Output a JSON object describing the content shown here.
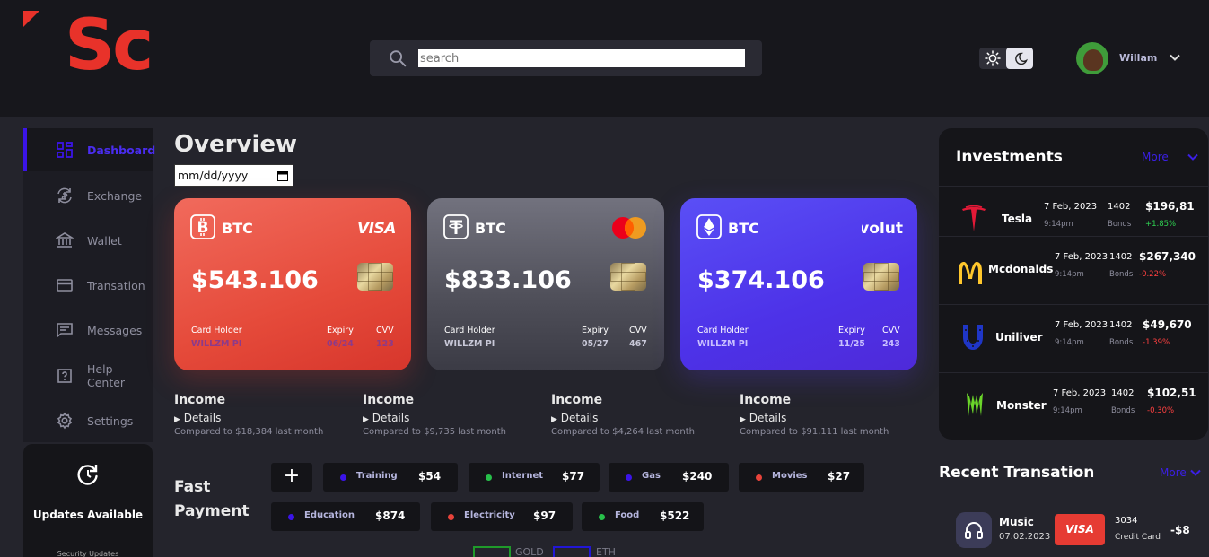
{
  "header": {
    "logo_text": "Sc",
    "search_placeholder": "search",
    "user_name": "Willam"
  },
  "sidebar": {
    "items": [
      {
        "label": "Dashboard",
        "icon": "dashboard-icon",
        "active": true
      },
      {
        "label": "Exchange",
        "icon": "exchange-icon"
      },
      {
        "label": "Wallet",
        "icon": "bank-icon"
      },
      {
        "label": "Transation",
        "icon": "card-icon"
      },
      {
        "label": "Messages",
        "icon": "message-icon"
      },
      {
        "label": "Help Center",
        "icon": "help-icon"
      },
      {
        "label": "Settings",
        "icon": "gear-icon"
      }
    ],
    "updates": {
      "title": "Updates Available",
      "subtitle": "Security Updates"
    }
  },
  "overview": {
    "title": "Overview",
    "date_value": "mm/dd/yyyy"
  },
  "cards": [
    {
      "coin": "BTC",
      "brand": "VISA",
      "amount": "$543.106",
      "holder_label": "Card Holder",
      "holder": "WILLZM PI",
      "expiry_label": "Expiry",
      "expiry": "06/24",
      "cvv_label": "CVV",
      "cvv": "123"
    },
    {
      "coin": "BTC",
      "brand": "mastercard",
      "amount": "$833.106",
      "holder_label": "Card Holder",
      "holder": "WILLZM PI",
      "expiry_label": "Expiry",
      "expiry": "05/27",
      "cvv_label": "CVV",
      "cvv": "467"
    },
    {
      "coin": "BTC",
      "brand": "Revolut",
      "amount": "$374.106",
      "holder_label": "Card Holder",
      "holder": "WILLZM PI",
      "expiry_label": "Expiry",
      "expiry": "11/25",
      "cvv_label": "CVV",
      "cvv": "243"
    }
  ],
  "income": [
    {
      "title": "Income",
      "details": "Details",
      "compare": "Compared to $18,384 last month"
    },
    {
      "title": "Income",
      "details": "Details",
      "compare": "Compared to $9,735 last month"
    },
    {
      "title": "Income",
      "details": "Details",
      "compare": "Compared to $4,264 last month"
    },
    {
      "title": "Income",
      "details": "Details",
      "compare": "Compared to $91,111 last month"
    }
  ],
  "fast_payment": {
    "title_line1": "Fast",
    "title_line2": "Payment",
    "add_label": "+",
    "items": [
      {
        "name": "Training",
        "amount": "$54",
        "color": "#3b14e8"
      },
      {
        "name": "Internet",
        "amount": "$77",
        "color": "#27c04a"
      },
      {
        "name": "Gas",
        "amount": "$240",
        "color": "#3b14e8"
      },
      {
        "name": "Movies",
        "amount": "$27",
        "color": "#e8433a"
      },
      {
        "name": "Education",
        "amount": "$874",
        "color": "#3b14e8"
      },
      {
        "name": "Electricity",
        "amount": "$97",
        "color": "#e8433a"
      },
      {
        "name": "Food",
        "amount": "$522",
        "color": "#27c04a"
      }
    ]
  },
  "chart_legend": [
    {
      "label": "GOLD",
      "color": "#1f9a2a"
    },
    {
      "label": "ETH",
      "color": "#2216d6"
    }
  ],
  "investments": {
    "title": "Investments",
    "more": "More",
    "rows": [
      {
        "name": "Tesla",
        "icon": "tesla-icon",
        "date": "7 Feb, 2023",
        "time": "9:14pm",
        "qty": "1402",
        "unit": "Bonds",
        "price": "$196,81",
        "change": "+1.85%",
        "change_color": "#2fd352"
      },
      {
        "name": "Mcdonalds",
        "icon": "mcdonalds-icon",
        "date": "7 Feb, 2023",
        "time": "9:14pm",
        "qty": "1402",
        "unit": "Bonds",
        "price": "$267,340",
        "change": "-0.22%",
        "change_color": "#ff4040"
      },
      {
        "name": "Uniliver",
        "icon": "unilever-icon",
        "date": "7 Feb, 2023",
        "time": "9:14pm",
        "qty": "1402",
        "unit": "Bonds",
        "price": "$49,670",
        "change": "-1.39%",
        "change_color": "#ff4040"
      },
      {
        "name": "Monster",
        "icon": "monster-icon",
        "date": "7 Feb, 2023",
        "time": "9:14pm",
        "qty": "1402",
        "unit": "Bonds",
        "price": "$102,51",
        "change": "-0.30%",
        "change_color": "#ff4040"
      }
    ]
  },
  "recent": {
    "title": "Recent Transation",
    "more": "More",
    "rows": [
      {
        "name": "Music",
        "date": "07.02.2023",
        "card_brand": "VISA",
        "card_number": "3034",
        "card_type": "Credit Card",
        "amount": "-$8"
      }
    ]
  }
}
